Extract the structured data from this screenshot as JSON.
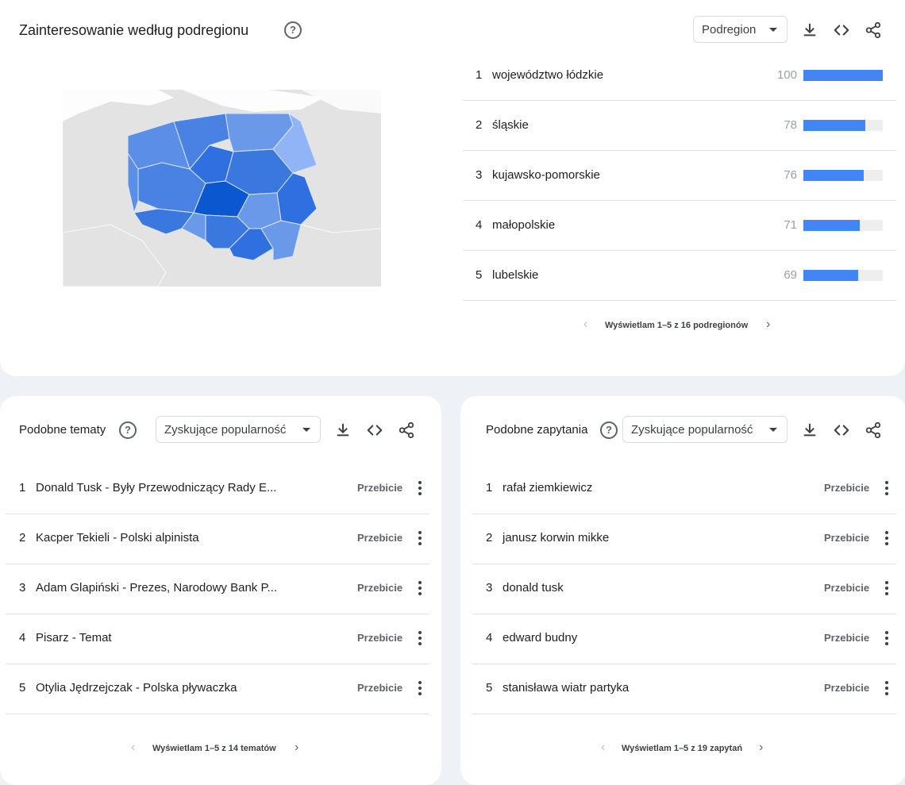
{
  "region": {
    "title": "Zainteresowanie według podregionu",
    "dropdown": "Podregion",
    "rows": [
      {
        "rank": "1",
        "name": "województwo łódzkie",
        "value": "100",
        "score": 100
      },
      {
        "rank": "2",
        "name": "śląskie",
        "value": "78",
        "score": 78
      },
      {
        "rank": "3",
        "name": "kujawsko-pomorskie",
        "value": "76",
        "score": 76
      },
      {
        "rank": "4",
        "name": "małopolskie",
        "value": "71",
        "score": 71
      },
      {
        "rank": "5",
        "name": "lubelskie",
        "value": "69",
        "score": 69
      }
    ],
    "pager": "Wyświetlam 1–5 z 16 podregionów"
  },
  "topics": {
    "title": "Podobne tematy",
    "dropdown": "Zyskujące popularność",
    "rows": [
      {
        "rank": "1",
        "name": "Donald Tusk - Były Przewodniczący Rady E...",
        "value": "Przebicie"
      },
      {
        "rank": "2",
        "name": "Kacper Tekieli - Polski alpinista",
        "value": "Przebicie"
      },
      {
        "rank": "3",
        "name": "Adam Glapiński - Prezes, Narodowy Bank P...",
        "value": "Przebicie"
      },
      {
        "rank": "4",
        "name": "Pisarz - Temat",
        "value": "Przebicie"
      },
      {
        "rank": "5",
        "name": "Otylia Jędrzejczak - Polska pływaczka",
        "value": "Przebicie"
      }
    ],
    "pager": "Wyświetlam 1–5 z 14 tematów"
  },
  "queries": {
    "title": "Podobne zapytania",
    "dropdown": "Zyskujące popularność",
    "rows": [
      {
        "rank": "1",
        "name": "rafał ziemkiewicz",
        "value": "Przebicie"
      },
      {
        "rank": "2",
        "name": "janusz korwin mikke",
        "value": "Przebicie"
      },
      {
        "rank": "3",
        "name": "donald tusk",
        "value": "Przebicie"
      },
      {
        "rank": "4",
        "name": "edward budny",
        "value": "Przebicie"
      },
      {
        "rank": "5",
        "name": "stanisława wiatr partyka",
        "value": "Przebicie"
      }
    ],
    "pager": "Wyświetlam 1–5 z 19 zapytań"
  },
  "colors": {
    "bar": "#4285f4",
    "map_land": "#e3e3e3",
    "map_high": "#0b57d0",
    "map_mid": "#3a78e0",
    "map_low": "#90b4f5"
  },
  "icons": [
    "help-icon",
    "download-icon",
    "embed-icon",
    "share-icon",
    "chevron-left-icon",
    "chevron-right-icon",
    "more-vert-icon",
    "dropdown-caret-icon"
  ]
}
